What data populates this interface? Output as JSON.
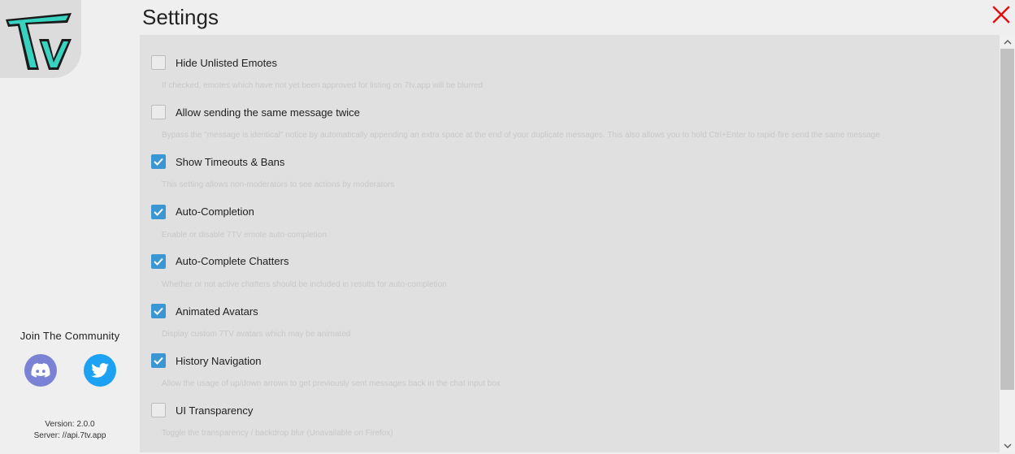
{
  "header": {
    "title": "Settings",
    "close_icon": "close-icon",
    "close_color": "#e01010"
  },
  "sidebar": {
    "logo_text": "7TV",
    "community_label": "Join The Community",
    "social": [
      {
        "name": "discord",
        "icon": "discord-icon",
        "color": "#7b82d6"
      },
      {
        "name": "twitter",
        "icon": "twitter-icon",
        "color": "#1da1f2"
      }
    ],
    "version": "Version: 2.0.0",
    "server": "Server: //api.7tv.app"
  },
  "settings": [
    {
      "label": "Hide Unlisted Emotes",
      "checked": false,
      "description": "If checked, emotes which have not yet been approved for listing on 7tv.app will be blurred"
    },
    {
      "label": "Allow sending the same message twice",
      "checked": false,
      "description": "Bypass the \"message is identical\" notice by automatically appending an extra space at the end of your duplicate messages. This also allows you to hold Ctrl+Enter to rapid-fire send the same message"
    },
    {
      "label": "Show Timeouts & Bans",
      "checked": true,
      "description": "This setting allows non-moderators to see actions by moderators"
    },
    {
      "label": "Auto-Completion",
      "checked": true,
      "description": "Enable or disable 7TV emote auto-completion"
    },
    {
      "label": "Auto-Complete Chatters",
      "checked": true,
      "description": "Whether or not active chatters should be included in results for auto-completion"
    },
    {
      "label": "Animated Avatars",
      "checked": true,
      "description": "Display custom 7TV avatars which may be animated"
    },
    {
      "label": "History Navigation",
      "checked": true,
      "description": "Allow the usage of up/down arrows to get previously sent messages back in the chat input box"
    },
    {
      "label": "UI Transparency",
      "checked": false,
      "description": "Toggle the transparency / backdrop blur (Unavailable on Firefox)"
    }
  ],
  "colors": {
    "accent": "#3a97d4",
    "panel": "#e0e0e0",
    "background": "#efefef"
  }
}
